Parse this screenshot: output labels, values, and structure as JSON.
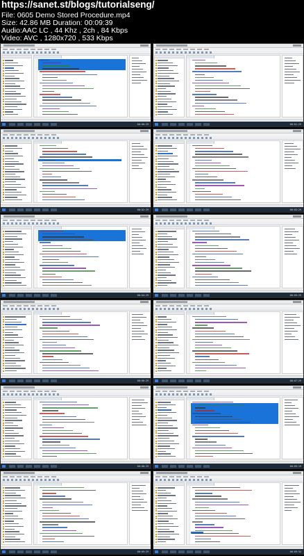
{
  "header": {
    "url": "https://sanet.st/blogs/tutorialseng/",
    "file_line": "File: 0605 Demo Stored Procedure.mp4",
    "size_line": "Size: 42.86 MB Duration: 00:09:39",
    "audio_line": "Audio:AAC LC , 44 Khz , 2ch , 84 Kbps",
    "video_line": "Video: AVC , 1280x720 , 533 Kbps"
  },
  "thumbnails": [
    {
      "time": "00:00:29",
      "highlight": "top"
    },
    {
      "time": "00:01:29",
      "highlight": "none"
    },
    {
      "time": "00:02:29",
      "highlight": "line"
    },
    {
      "time": "00:03:29",
      "highlight": "none"
    },
    {
      "time": "00:04:29",
      "highlight": "top"
    },
    {
      "time": "00:05:29",
      "highlight": "none"
    },
    {
      "time": "00:06:29",
      "highlight": "none"
    },
    {
      "time": "00:07:29",
      "highlight": "none"
    },
    {
      "time": "00:08:29",
      "highlight": "none"
    },
    {
      "time": "00:09:19",
      "highlight": "right-block"
    },
    {
      "time": "00:09:29",
      "highlight": "none"
    },
    {
      "time": "00:09:34",
      "highlight": "small"
    }
  ],
  "colors": {
    "background": "#000000",
    "header_text": "#ffffff",
    "selection": "#1a73d9",
    "ide_background": "#f4f4f4",
    "taskbar": "#1d2a3a"
  }
}
